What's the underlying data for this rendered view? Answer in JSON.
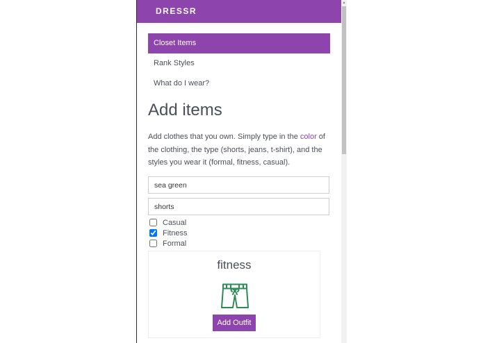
{
  "app": {
    "brand": "DRESSR",
    "accent_color": "#8e44ad"
  },
  "nav": {
    "items": [
      {
        "label": "Closet Items",
        "active": true
      },
      {
        "label": "Rank Styles",
        "active": false
      },
      {
        "label": "What do I wear?",
        "active": false
      }
    ]
  },
  "main": {
    "heading": "Add items",
    "intro_before": "Add clothes that you own. Simply type in the ",
    "intro_accent": "color",
    "intro_after": " of the clothing, the type (shorts, jeans, t-shirt), and the styles you wear it (formal, fitness, casual).",
    "color_input": {
      "value": "sea green"
    },
    "type_input": {
      "value": "shorts"
    },
    "styles": [
      {
        "label": "Casual",
        "checked": false
      },
      {
        "label": "Fitness",
        "checked": true
      },
      {
        "label": "Formal",
        "checked": false
      }
    ]
  },
  "card": {
    "title": "fitness",
    "icon": "shorts-icon",
    "icon_color": "#2e8b57",
    "button_label": "Add Outfit"
  }
}
